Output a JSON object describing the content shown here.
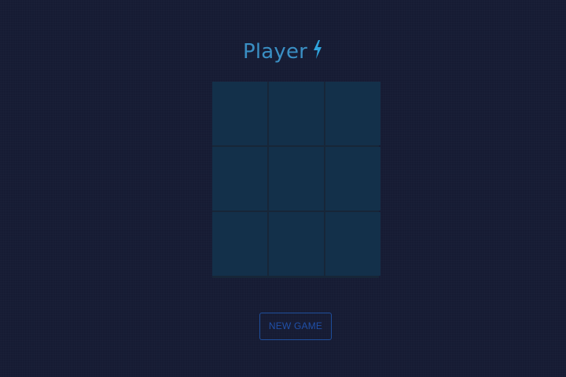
{
  "header": {
    "player_label": "Player",
    "turn_icon": "bolt-icon"
  },
  "board": {
    "cells": [
      "",
      "",
      "",
      "",
      "",
      "",
      "",
      "",
      ""
    ]
  },
  "controls": {
    "new_game_label": "NEW GAME"
  },
  "colors": {
    "background": "#161b33",
    "accent": "#3a8fc4",
    "bolt": "#2fa3dc",
    "cell": "#13304a",
    "button": "#2050a8"
  }
}
